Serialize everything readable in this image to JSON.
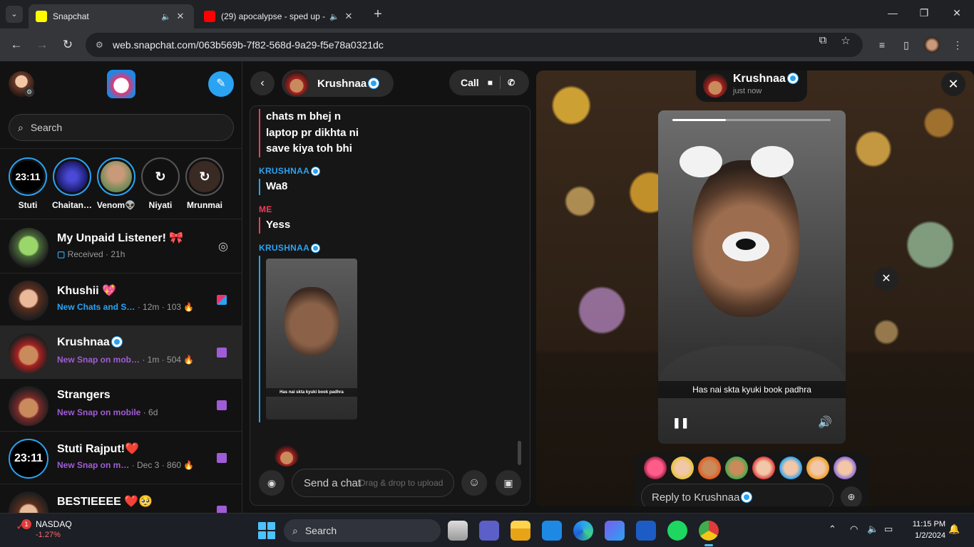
{
  "browser": {
    "tabs": [
      {
        "title": "Snapchat",
        "active": true
      },
      {
        "title": "(29) apocalypse - sped up -",
        "active": false
      }
    ],
    "url": "web.snapchat.com/063b569b-7f82-568d-9a29-f5e78a0321dc"
  },
  "sidebar": {
    "search_placeholder": "Search",
    "stories": [
      {
        "name": "Stuti",
        "label": "23:11"
      },
      {
        "name": "Chaitan…",
        "label": ""
      },
      {
        "name": "Venom👽",
        "label": ""
      },
      {
        "name": "Niyati",
        "label": "↻"
      },
      {
        "name": "Mrunmai",
        "label": "↻"
      }
    ],
    "chats": [
      {
        "name": "My Unpaid Listener! 🎀",
        "status_main": "Received",
        "status_meta": " · 21h",
        "status_color": "#9a9a9a"
      },
      {
        "name": "Khushii 💖",
        "status_main": "New Chats and S…",
        "status_meta": " · 12m · 103 🔥",
        "status_color": "#2aa3f2"
      },
      {
        "name": "Krushnaa",
        "status_main": "New Snap on mob…",
        "status_meta": " · 1m · 504 🔥",
        "status_color": "#a05cd6"
      },
      {
        "name": "Strangers",
        "status_main": "New Snap on mobile",
        "status_meta": " · 6d",
        "status_color": "#a05cd6"
      },
      {
        "name": "Stuti Rajput!❤️",
        "status_main": "New Snap on m…",
        "status_meta": " · Dec 3 · 860 🔥",
        "status_color": "#a05cd6"
      },
      {
        "name": "BESTIEEEE ❤️🥺",
        "status_main": "",
        "status_meta": "",
        "status_color": "#a05cd6"
      }
    ]
  },
  "chat": {
    "contact_name": "Krushnaa",
    "call_label": "Call",
    "messages": [
      {
        "sender": "",
        "lines": [
          "chats m bhej n",
          "laptop pr dikhta ni",
          "save kiya toh bhi"
        ],
        "color": "#f23c57"
      },
      {
        "sender": "KRUSHNAA",
        "lines": [
          "Wa8"
        ],
        "color": "#2aa3f2"
      },
      {
        "sender": "ME",
        "lines": [
          "Yess"
        ],
        "color": "#f23c57"
      },
      {
        "sender": "KRUSHNAA",
        "lines": [],
        "color": "#2aa3f2"
      }
    ],
    "snap_caption": "Has nai skta kyuki book padhra",
    "composer_placeholder": "Send a chat",
    "composer_drag_hint": "Drag & drop to upload"
  },
  "viewer": {
    "sender_name": "Krushnaa",
    "time": "just now",
    "caption": "Has nai skta kyuki book padhra",
    "progress": 0.34,
    "reply_placeholder": "Reply to Krushnaa"
  },
  "taskbar": {
    "stock_name": "NASDAQ",
    "stock_change": "-1.27%",
    "stock_badge": "1",
    "search_label": "Search",
    "time": "11:15 PM",
    "date": "1/2/2024"
  },
  "colors": {
    "accent_blue": "#2aa3f2",
    "me_red": "#f23c57",
    "snap_purple": "#a05cd6",
    "chat_red": "#e03b3b"
  }
}
